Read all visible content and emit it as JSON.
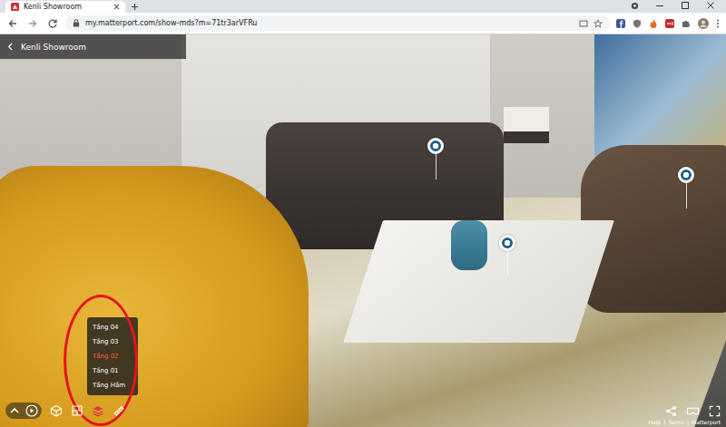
{
  "browser": {
    "tab": {
      "title": "Kenli Showroom",
      "selected": true
    },
    "url": "my.matterport.com/show-mds?m=71tr3arVFRu"
  },
  "tour": {
    "title": "Kenli Showroom"
  },
  "floor_menu": {
    "items": [
      {
        "label": "Tầng 04",
        "selected": false
      },
      {
        "label": "Tầng 03",
        "selected": false
      },
      {
        "label": "Tầng 02",
        "selected": true
      },
      {
        "label": "Tầng 01",
        "selected": false
      },
      {
        "label": "Tầng Hầm",
        "selected": false
      }
    ]
  },
  "toolbar": {
    "floors_active": true
  },
  "footer": {
    "links": [
      "Help",
      "Terms",
      "Matterport"
    ],
    "separator": "|"
  }
}
